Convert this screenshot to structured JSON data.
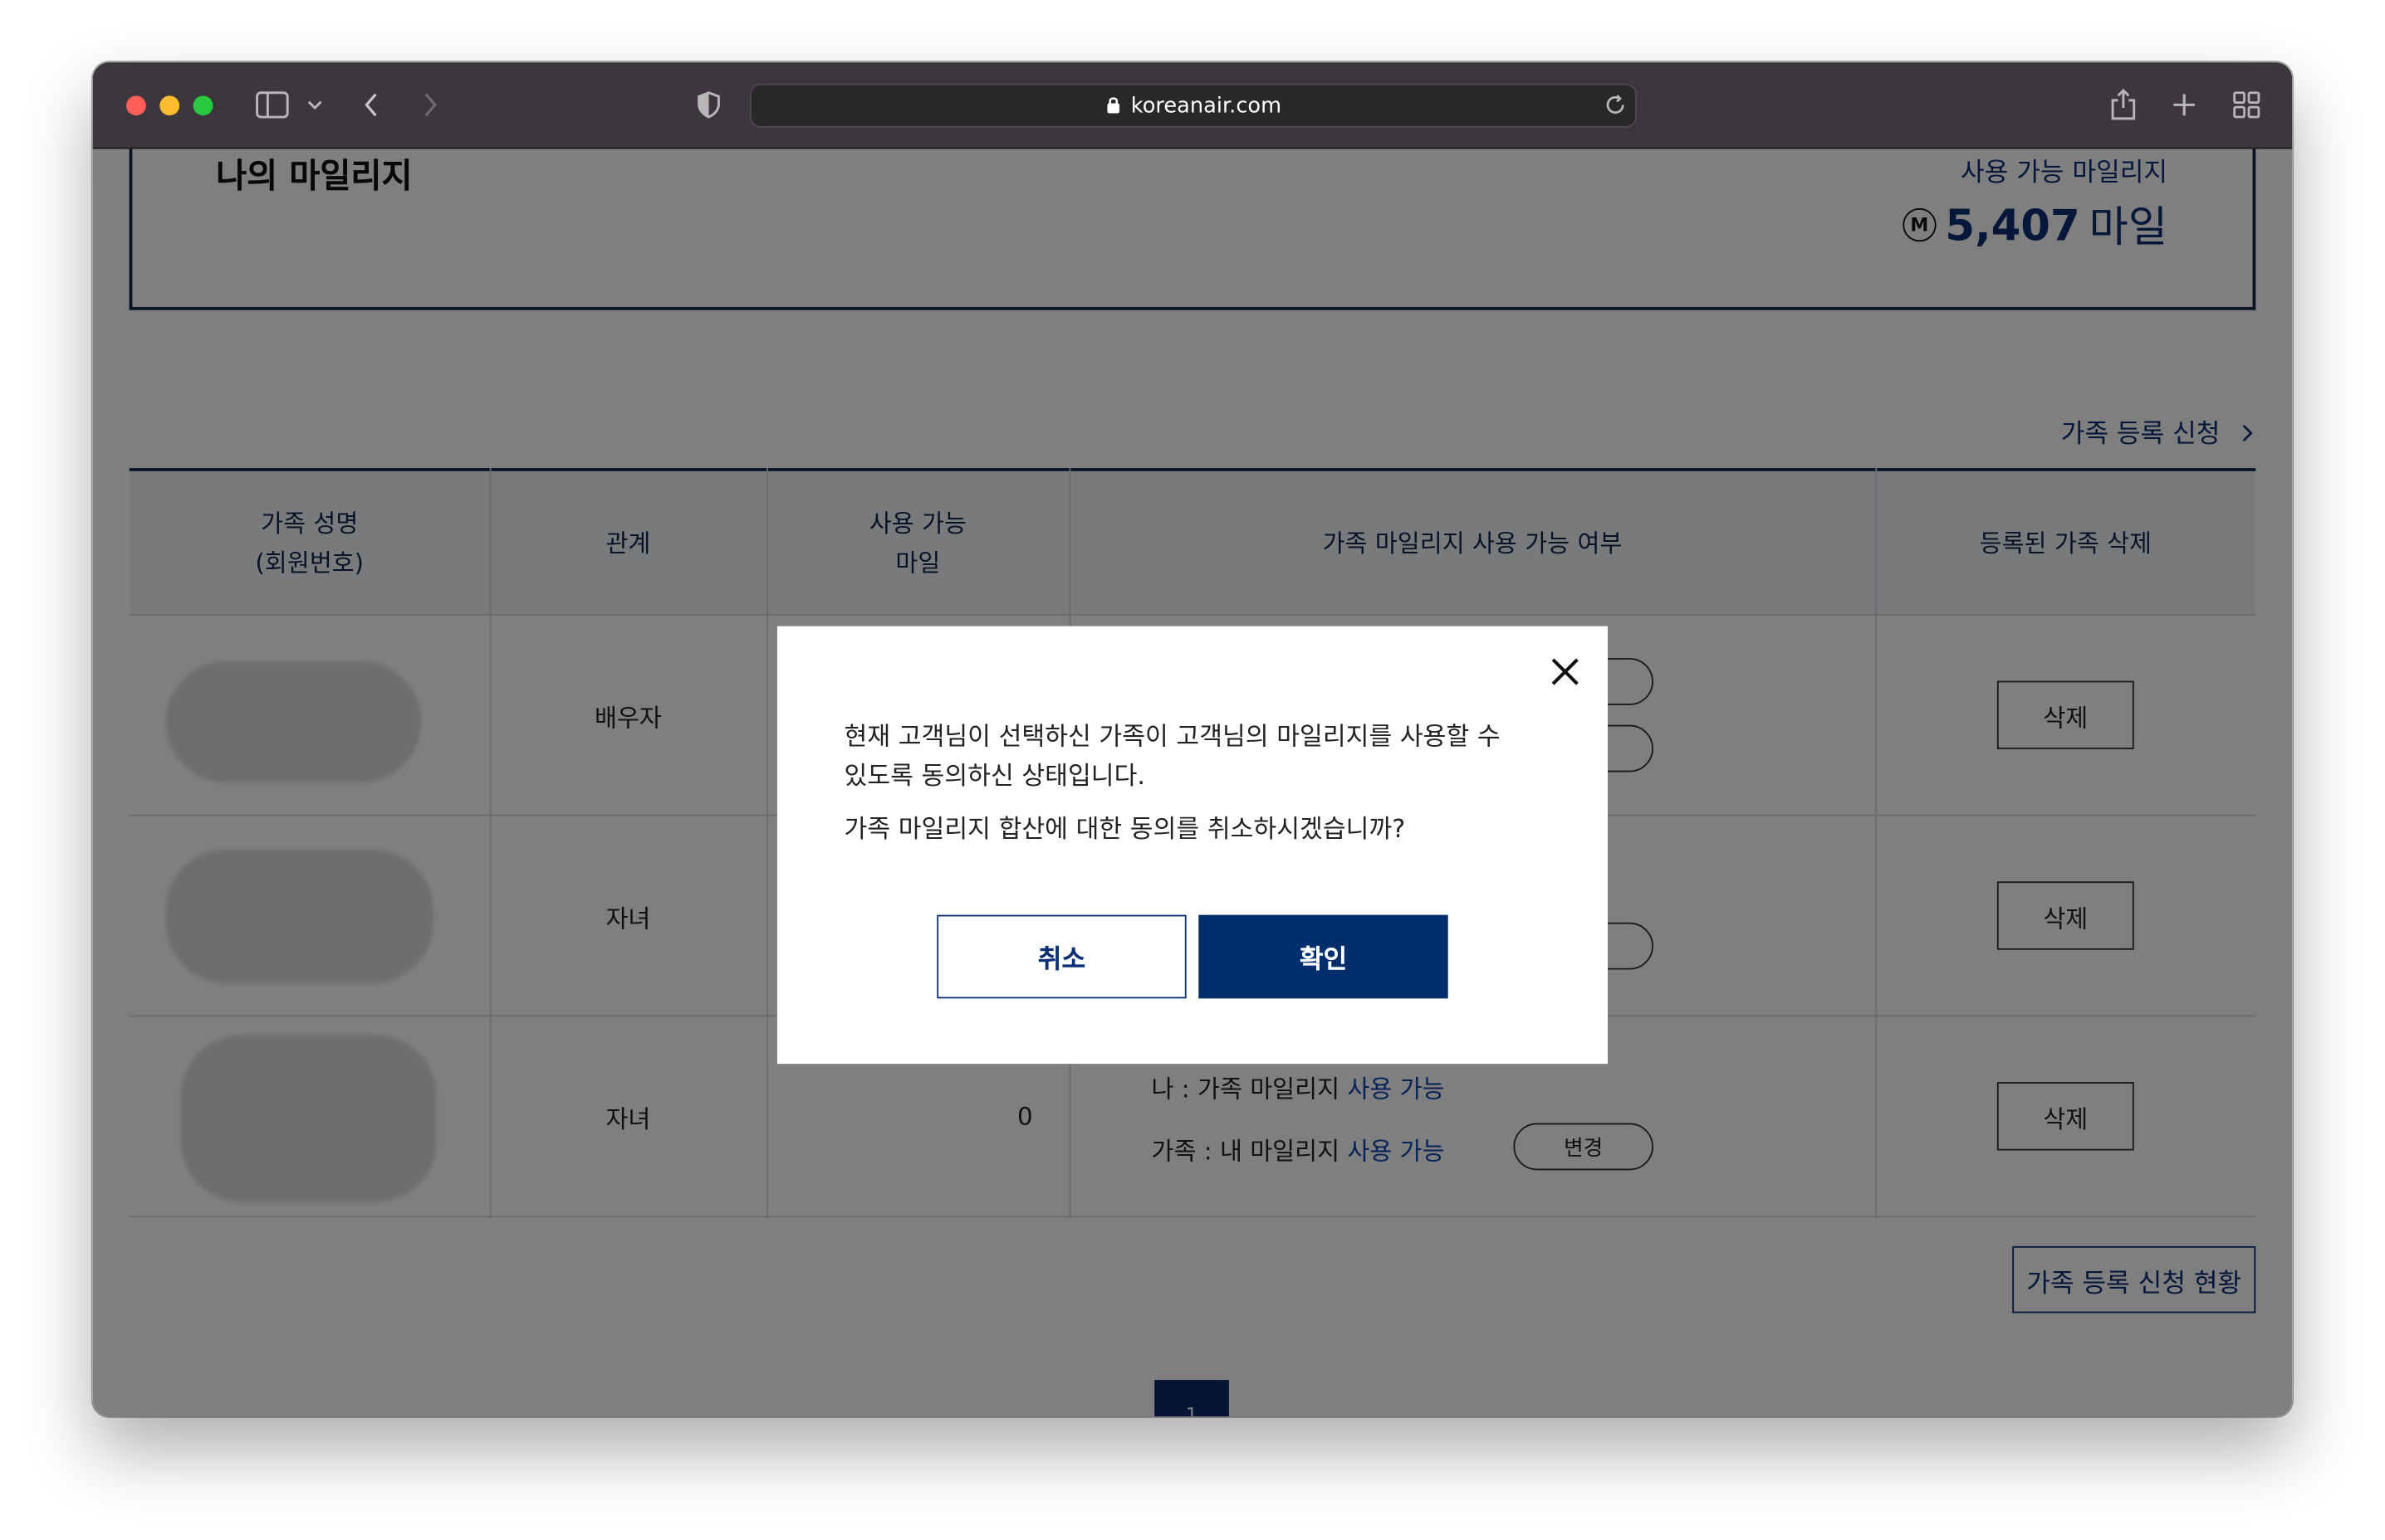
{
  "browser": {
    "url": "koreanair.com",
    "accent_colors": {
      "close": "#ff5f57",
      "minimize": "#febc2e",
      "zoom": "#28c840"
    }
  },
  "page": {
    "title": "나의 마일리지",
    "available_label": "사용 가능 마일리지",
    "available_value": "5,407",
    "available_unit": "마일",
    "mileage_badge": "M",
    "family_register_link": "가족 등록 신청",
    "table": {
      "headers": {
        "name_line1": "가족 성명",
        "name_line2": "(회원번호)",
        "relation": "관계",
        "available_line1": "사용 가능",
        "available_line2": "마일",
        "usage_status": "가족 마일리지 사용 가능 여부",
        "delete": "등록된 가족 삭제"
      },
      "rows": [
        {
          "relation": "배우자",
          "delete_label": "삭제"
        },
        {
          "relation": "자녀",
          "delete_label": "삭제"
        },
        {
          "relation": "자녀",
          "miles": "0",
          "status_me_prefix": "나 : 가족 마일리지 ",
          "status_me_value": "사용 가능",
          "status_family_prefix": "가족 : 내 마일리지 ",
          "status_family_value": "사용 가능",
          "change_label": "변경",
          "delete_label": "삭제"
        }
      ]
    },
    "history_button": "가족 등록 신청 현황",
    "pager_current": "1"
  },
  "modal": {
    "message_line1": "현재 고객님이 선택하신 가족이 고객님의 마일리지를 사용할 수",
    "message_line2": "있도록 동의하신 상태입니다.",
    "question": "가족 마일리지 합산에 대한 동의를 취소하시겠습니까?",
    "cancel_label": "취소",
    "confirm_label": "확인"
  }
}
